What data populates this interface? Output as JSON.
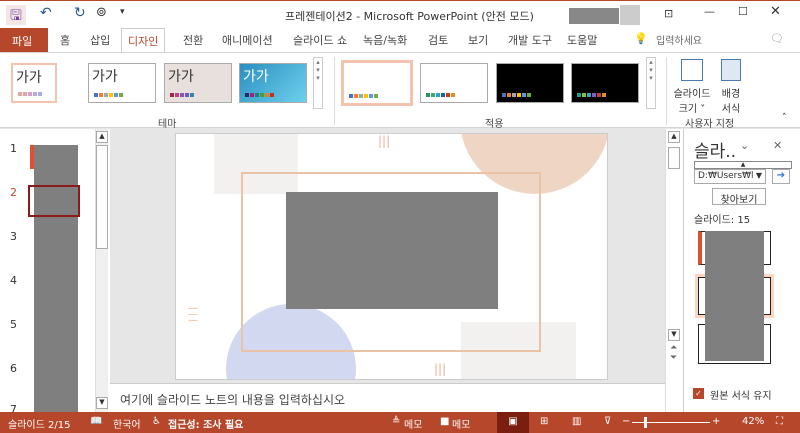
{
  "title": "프레젠테이션2  -  Microsoft PowerPoint (안전 모드)",
  "tabs": [
    "파일",
    "홈",
    "삽입",
    "디자인",
    "전환",
    "애니메이션",
    "슬라이드 쇼",
    "녹음/녹화",
    "검토",
    "보기",
    "개발 도구",
    "도움말"
  ],
  "tell_me": "입력하세요",
  "ribbon": {
    "theme_sample": "가가",
    "group_theme": "테마",
    "group_variants": "적용",
    "slide_size": "슬라이드",
    "slide_size2": "크기 ˅",
    "bg_format": "배경",
    "bg_format2": "서식",
    "group_customize": "사용자 지정"
  },
  "colors": {
    "accent": "#b7472a"
  },
  "thumbs": [
    "1",
    "2",
    "3",
    "4",
    "5",
    "6",
    "7"
  ],
  "notes_placeholder": "여기에 슬라이드 노트의 내용을 입력하십시오",
  "pane": {
    "title": "슬라..",
    "path": "D:₩Users₩l",
    "browse": "찾아보기",
    "count": "슬라이드: 15",
    "keep_format": "원본 서식 유지"
  },
  "status": {
    "slide": "슬라이드 2/15",
    "lang": "한국어",
    "access": "접근성: 조사 필요",
    "notes": "메모",
    "comments": "메모",
    "zoom": "42%"
  }
}
